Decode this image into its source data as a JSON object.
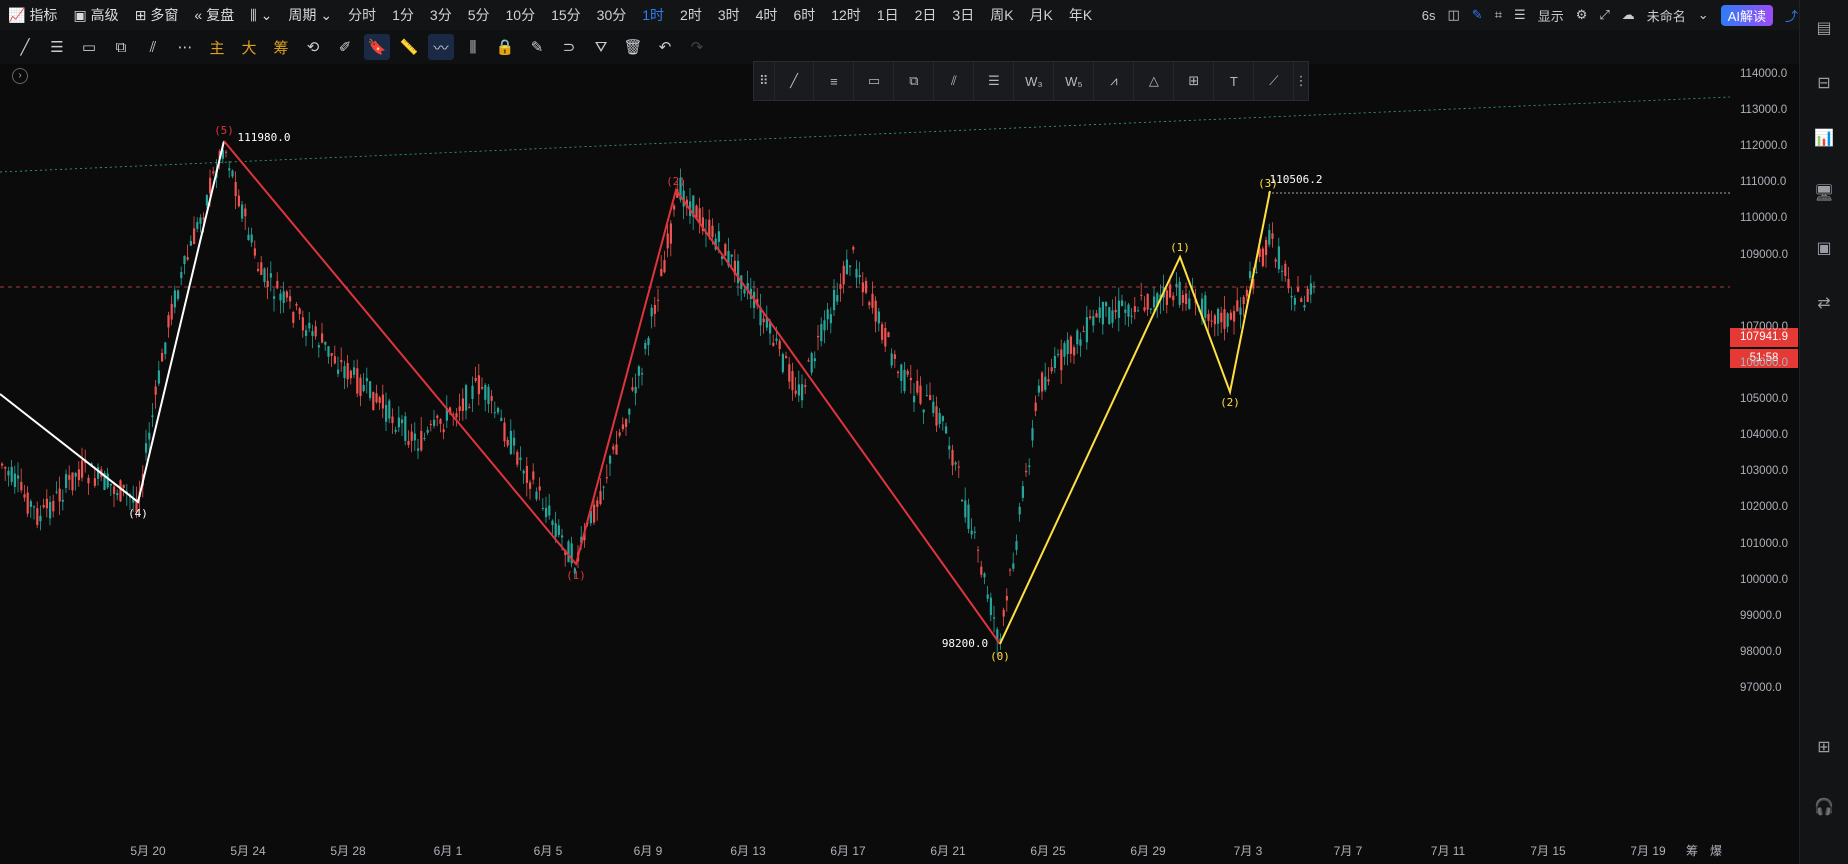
{
  "topbar": {
    "indicator": "指标",
    "advanced": "高级",
    "multi_window": "多窗",
    "replay": "复盘",
    "period": "周期",
    "timeframes": [
      "分时",
      "1分",
      "3分",
      "5分",
      "10分",
      "15分",
      "30分",
      "1时",
      "2时",
      "3时",
      "4时",
      "6时",
      "12时",
      "1日",
      "2日",
      "3日",
      "周K",
      "月K",
      "年K"
    ],
    "active_timeframe": "1时",
    "refresh": "6s",
    "display": "显示",
    "cloud_name": "未命名",
    "ai_label": "AI解读"
  },
  "toolbar": {
    "main_label": "主",
    "big_label": "大",
    "chip_label": "筹"
  },
  "price_axis": {
    "labels": [
      "114000.0",
      "113000.0",
      "112000.0",
      "111000.0",
      "110000.0",
      "109000.0",
      "107000.0",
      "106000.0",
      "105000.0",
      "104000.0",
      "103000.0",
      "102000.0",
      "101000.0",
      "100000.0",
      "99000.0",
      "98000.0",
      "97000.0"
    ],
    "current_price": "107941.9",
    "countdown": "51:58"
  },
  "time_axis": {
    "labels": [
      "5月 20",
      "5月 24",
      "5月 28",
      "6月 1",
      "6月 5",
      "6月 9",
      "6月 13",
      "6月 17",
      "6月 21",
      "6月 25",
      "6月 29",
      "7月 3",
      "7月 7",
      "7月 11",
      "7月 15",
      "7月 19"
    ],
    "corner_left": "筹",
    "corner_right": "爆"
  },
  "chart_data": {
    "type": "candlestick",
    "symbol_interval": "1时",
    "price_range": [
      96500,
      114500
    ],
    "current_price": 107941.9,
    "annotations": [
      {
        "label": "(4)",
        "price": 102100,
        "date": "5月 20"
      },
      {
        "label": "(5)",
        "price": 111980,
        "date": "5月 23"
      },
      {
        "label": "(1)",
        "price": 100400,
        "date": "6月 5"
      },
      {
        "label": "(2)",
        "price": 110600,
        "date": "6月 9"
      },
      {
        "label": "(0)",
        "price": 98200,
        "date": "6月 22"
      },
      {
        "label": "(1)",
        "price": 108800,
        "date": "6月 30"
      },
      {
        "label": "(2)",
        "price": 105100,
        "date": "7月 2"
      },
      {
        "label": "(3)",
        "price": 110506.2,
        "date": "7月 3"
      }
    ],
    "price_tags": [
      "111980.0",
      "98200.0",
      "110506.2"
    ],
    "wave_colors": {
      "white": "#ffffff",
      "red": "#e0343d",
      "yellow": "#ffe040"
    }
  },
  "colors": {
    "up": "#26a69a",
    "down": "#ef5350",
    "accent": "#2f7cf6",
    "background": "#0b0b0c"
  }
}
